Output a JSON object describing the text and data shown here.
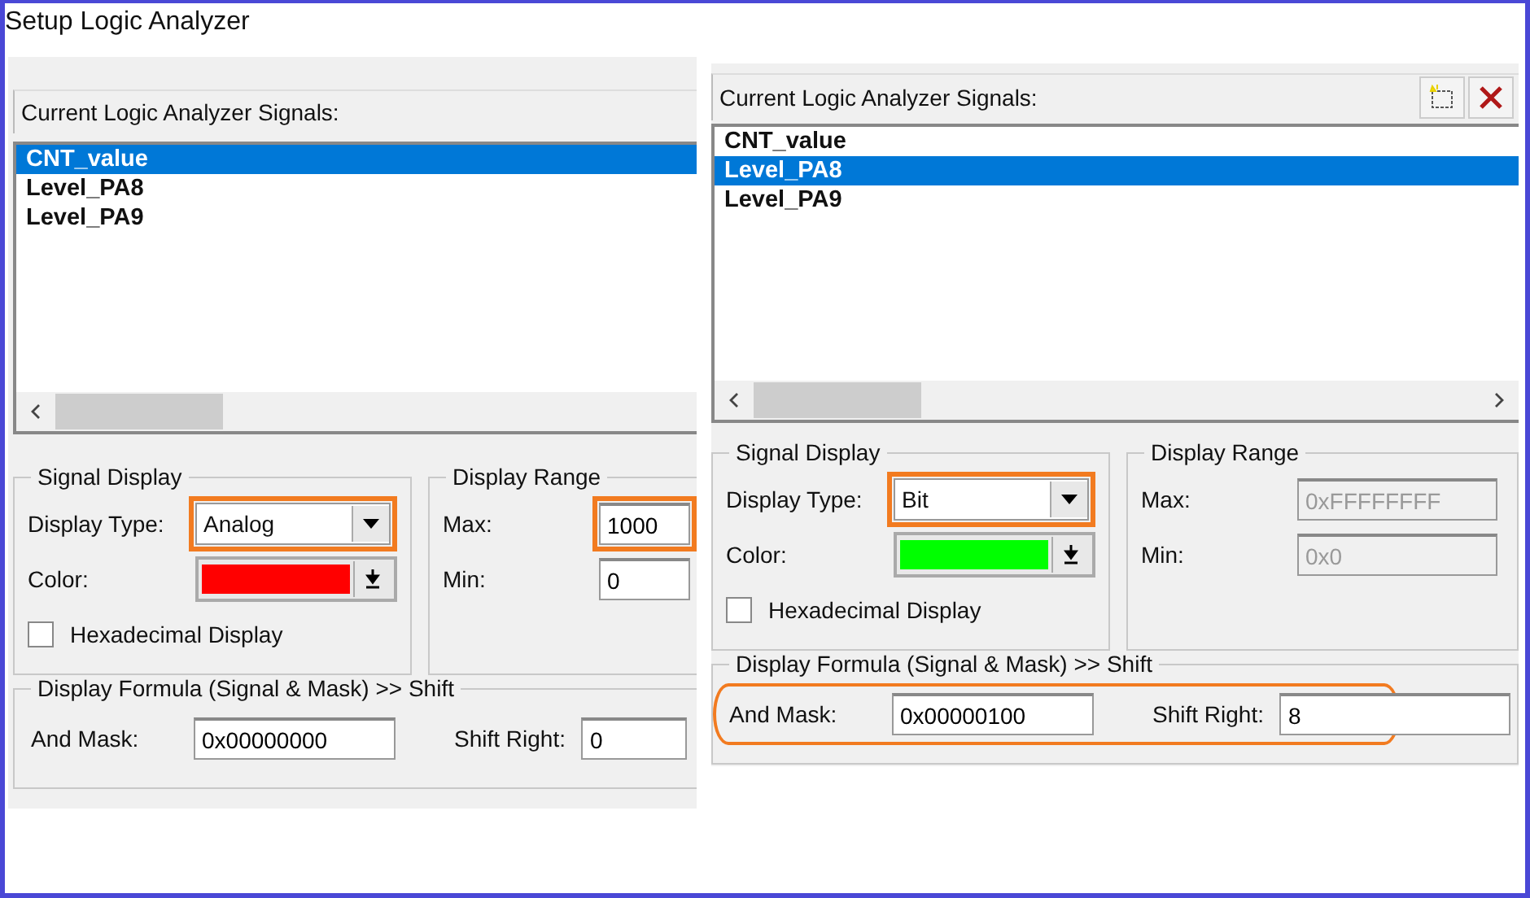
{
  "window": {
    "title": "Setup Logic Analyzer"
  },
  "panels": [
    {
      "signals_label": "Current Logic Analyzer Signals:",
      "signals": [
        {
          "name": "CNT_value",
          "selected": true
        },
        {
          "name": "Level_PA8",
          "selected": false
        },
        {
          "name": "Level_PA9",
          "selected": false
        }
      ],
      "signal_display": {
        "title": "Signal Display",
        "type_label": "Display Type:",
        "type_value": "Analog",
        "type_highlighted": true,
        "color_label": "Color:",
        "color": "#ff0000",
        "hex_label": "Hexadecimal Display",
        "hex_checked": false
      },
      "display_range": {
        "title": "Display Range",
        "max_label": "Max:",
        "max_value": "1000",
        "max_highlighted": true,
        "min_label": "Min:",
        "min_value": "0",
        "disabled": false
      },
      "formula": {
        "title": "Display Formula (Signal & Mask) >> Shift",
        "mask_label": "And Mask:",
        "mask_value": "0x00000000",
        "shift_label": "Shift Right:",
        "shift_value": "0",
        "highlighted": false
      }
    },
    {
      "signals_label": "Current Logic Analyzer Signals:",
      "toolbar_buttons": [
        {
          "kind": "new"
        },
        {
          "kind": "delete"
        }
      ],
      "signals": [
        {
          "name": "CNT_value",
          "selected": false
        },
        {
          "name": "Level_PA8",
          "selected": true
        },
        {
          "name": "Level_PA9",
          "selected": false
        }
      ],
      "signal_display": {
        "title": "Signal Display",
        "type_label": "Display Type:",
        "type_value": "Bit",
        "type_highlighted": true,
        "color_label": "Color:",
        "color": "#00ff00",
        "hex_label": "Hexadecimal Display",
        "hex_checked": false
      },
      "display_range": {
        "title": "Display Range",
        "max_label": "Max:",
        "max_value": "0xFFFFFFFF",
        "max_highlighted": false,
        "min_label": "Min:",
        "min_value": "0x0",
        "disabled": true
      },
      "formula": {
        "title": "Display Formula (Signal & Mask) >> Shift",
        "mask_label": "And Mask:",
        "mask_value": "0x00000100",
        "shift_label": "Shift Right:",
        "shift_value": "8",
        "highlighted": true
      }
    }
  ]
}
